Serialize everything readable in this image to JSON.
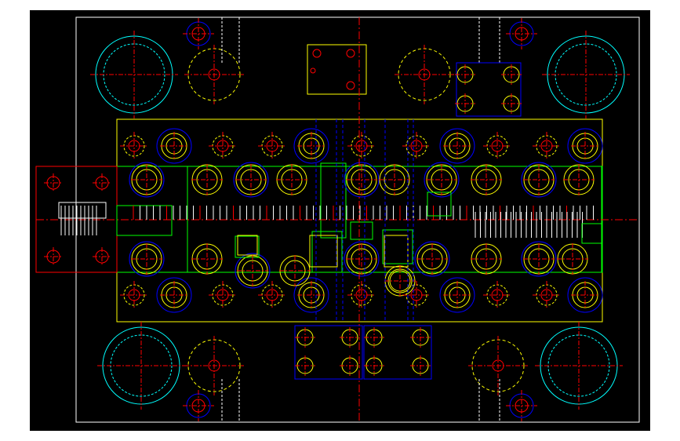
{
  "drawing": {
    "kind": "cad-die-layout",
    "background": "#000000",
    "page_background": "#ffffff",
    "colors": {
      "frame": "#ffffff",
      "center": "#ff0000",
      "hole": "#ff0000",
      "screw": "#ffff00",
      "outline": "#ffff00",
      "guide": "#00ffff",
      "counterbore": "#0000ff",
      "part": "#00ff00",
      "dim": "#ff00ff",
      "hidden": "#ffffff"
    },
    "layers": [
      "frame",
      "guide-posts",
      "screws",
      "pins",
      "die-insert",
      "strip",
      "stripper-plate",
      "side-blocks"
    ]
  }
}
